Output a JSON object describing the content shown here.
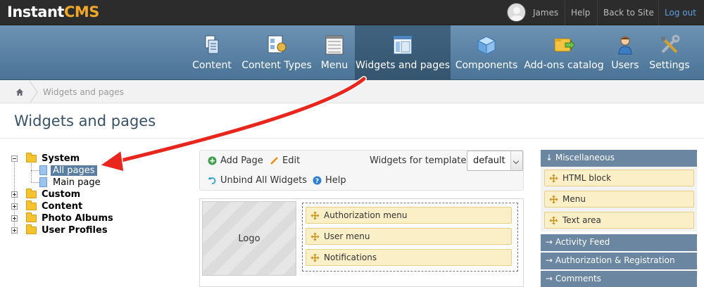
{
  "topbar": {
    "logo_a": "Instant",
    "logo_b": "CMS",
    "username": "James",
    "help": "Help",
    "back": "Back to Site",
    "logout": "Log out"
  },
  "nav": [
    {
      "label": "Content",
      "icon": "content-icon"
    },
    {
      "label": "Content Types",
      "icon": "content-types-icon"
    },
    {
      "label": "Menu",
      "icon": "menu-icon"
    },
    {
      "label": "Widgets and pages",
      "icon": "widgets-icon"
    },
    {
      "label": "Components",
      "icon": "components-icon"
    },
    {
      "label": "Add-ons catalog",
      "icon": "addons-icon"
    },
    {
      "label": "Users",
      "icon": "users-icon"
    },
    {
      "label": "Settings",
      "icon": "settings-icon"
    }
  ],
  "breadcrumb": {
    "current": "Widgets and pages"
  },
  "page_title": "Widgets and pages",
  "tree": {
    "system": "System",
    "all_pages": "All pages",
    "main_page": "Main page",
    "custom": "Custom",
    "content": "Content",
    "photo_albums": "Photo Albums",
    "user_profiles": "User Profiles"
  },
  "toolbar": {
    "add_page": "Add Page",
    "edit": "Edit",
    "unbind": "Unbind All Widgets",
    "help": "Help",
    "template_label": "Widgets for template",
    "template_value": "default"
  },
  "layout": {
    "logo": "Logo",
    "widgets": [
      "Authorization menu",
      "User menu",
      "Notifications"
    ]
  },
  "right_panel": {
    "misc": "↓ Miscellaneous",
    "items": [
      "HTML block",
      "Menu",
      "Text area"
    ],
    "activity": "→ Activity Feed",
    "auth": "→ Authorization & Registration",
    "comments": "→ Comments"
  },
  "colors": {
    "accent": "#f0a628",
    "nav": "#5a7fa2",
    "widget": "#fbefc8",
    "arrow": "#e8261e"
  }
}
